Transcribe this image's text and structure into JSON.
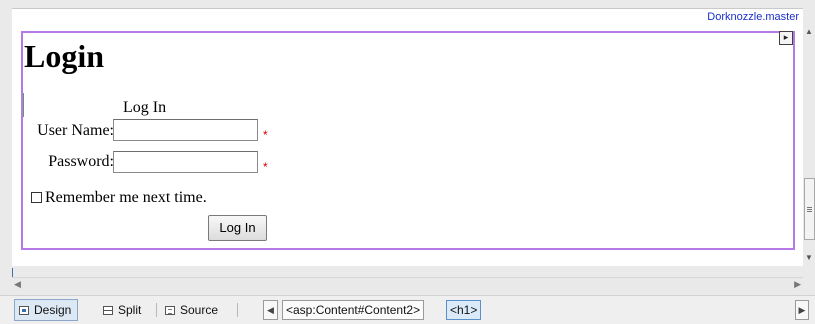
{
  "editor": {
    "master_page": "Dorknozzle.master",
    "page_title": "Login"
  },
  "login_control": {
    "title": "Log In",
    "username_label": "User Name:",
    "password_label": "Password:",
    "required_marker": "*",
    "remember_label": "Remember me next time.",
    "button_label": "Log In"
  },
  "view_tabs": [
    {
      "label": "Design",
      "icon": "design-view-icon",
      "active": true
    },
    {
      "label": "Split",
      "icon": "split-view-icon",
      "active": false
    },
    {
      "label": "Source",
      "icon": "source-view-icon",
      "active": false
    }
  ],
  "tag_navigator": [
    {
      "label": "<asp:Content#Content2>",
      "active": false
    },
    {
      "label": "<h1>",
      "active": true
    }
  ],
  "icons": {
    "smart_tag": "chevron-right-icon",
    "scroll_up": "arrow-up-icon",
    "scroll_down": "arrow-down-icon",
    "scroll_left": "arrow-left-icon",
    "scroll_right": "arrow-right-icon"
  },
  "colors": {
    "content_border": "#b779e6",
    "master_link": "#1a2fc9",
    "required": "#e00000",
    "active_crumb": "#dbeaf9"
  }
}
